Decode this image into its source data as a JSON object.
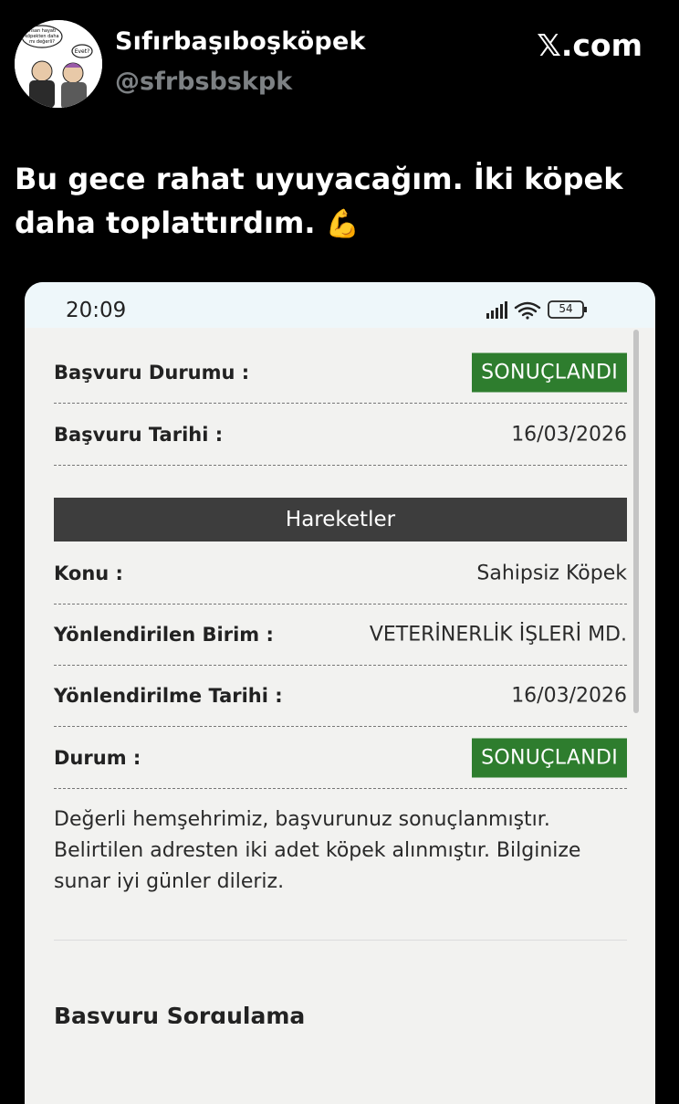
{
  "tweet": {
    "author_name": "Sıfırbaşıboşköpek",
    "author_handle": "@sfrbsbskpk",
    "site_logo": "𝕏.com",
    "text": "Bu gece rahat uyuyacağım. İki köpek daha toplattırdım.",
    "emoji": "💪",
    "avatar_bubble_left": "İnsan hayatı köpekten daha mı değerli?",
    "avatar_bubble_right": "Evet?"
  },
  "phone": {
    "status_time": "20:09",
    "battery": "54",
    "fields": [
      {
        "label": "Başvuru Durumu :",
        "value": "SONUÇLANDI"
      },
      {
        "label": "Başvuru Tarihi :",
        "value": "16/03/2026"
      }
    ],
    "section_header": "Hareketler",
    "details": [
      {
        "label": "Konu :",
        "value": "Sahipsiz Köpek"
      },
      {
        "label": "Yönlendirilen Birim :",
        "value": "VETERİNERLİK İŞLERİ MD."
      },
      {
        "label": "Yönlendirilme Tarihi :",
        "value": "16/03/2026"
      },
      {
        "label": "Durum :",
        "value": "SONUÇLANDI"
      }
    ],
    "message": "Değerli hemşehrimiz, başvurunuz sonuçlanmıştır. Belirtilen adresten iki adet köpek alınmıştır. Bilginize sunar iyi günler dileriz.",
    "bottom_heading": "Başvuru Sorgulama"
  },
  "colors": {
    "badge_green": "#2e7d2e",
    "section_header_bg": "#3d3d3d",
    "handle_gray": "#7d8184"
  }
}
